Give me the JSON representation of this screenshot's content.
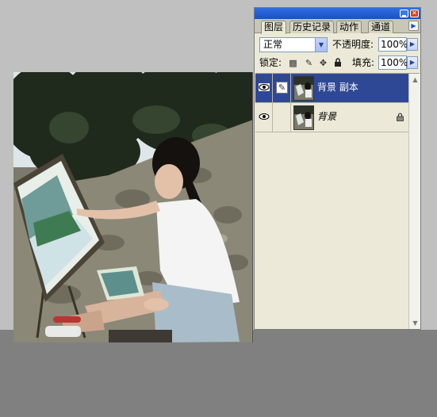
{
  "palette": {
    "tabs": [
      "图层",
      "历史记录",
      "动作",
      "通道"
    ],
    "blend_mode": "正常",
    "opacity_label": "不透明度:",
    "opacity_value": "100%",
    "lock_label": "锁定:",
    "fill_label": "填充:",
    "fill_value": "100%",
    "layers": [
      {
        "name": "背景 副本",
        "selected": true,
        "visible": true,
        "icon": "brush-icon"
      },
      {
        "name": "背景",
        "selected": false,
        "visible": true,
        "locked": true
      }
    ]
  },
  "icons": {
    "minimize": "minimize-icon",
    "close": "close-icon",
    "palette_menu": "triangle-right-icon",
    "eye": "eye-icon",
    "lock": "padlock-icon"
  },
  "colors": {
    "titlebar": "#1b50c5",
    "selected_layer": "#2f4896",
    "palette_bg": "#ece9d8",
    "workspace": "#c0c0c0"
  }
}
